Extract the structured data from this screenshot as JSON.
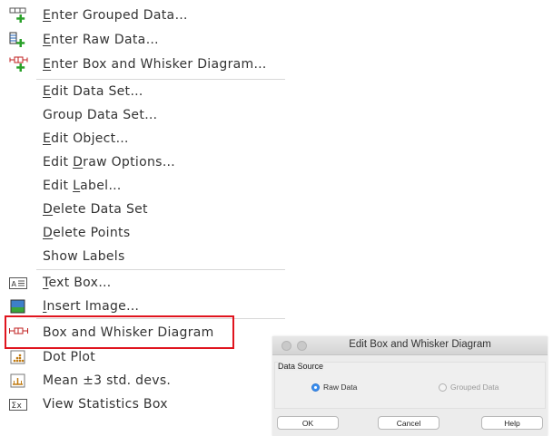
{
  "menu": {
    "items": [
      {
        "key": "enter_grouped",
        "prefix": "",
        "ul": "E",
        "rest": "nter Grouped Data…",
        "icon": "grouped-data-add-icon"
      },
      {
        "key": "enter_raw",
        "prefix": "",
        "ul": "E",
        "rest": "nter Raw Data…",
        "icon": "raw-data-add-icon"
      },
      {
        "key": "enter_box",
        "prefix": "",
        "ul": "E",
        "rest": "nter Box and Whisker Diagram…",
        "icon": "box-whisker-add-icon"
      },
      {
        "key": "edit_data_set",
        "prefix": "",
        "ul": "E",
        "rest": "dit Data Set…",
        "icon": ""
      },
      {
        "key": "group_data_set",
        "prefix": "Group Data Set…",
        "ul": "",
        "rest": "",
        "icon": ""
      },
      {
        "key": "edit_object",
        "prefix": "",
        "ul": "E",
        "rest": "dit Object…",
        "icon": ""
      },
      {
        "key": "edit_draw",
        "prefix": "Edit ",
        "ul": "D",
        "rest": "raw Options…",
        "icon": ""
      },
      {
        "key": "edit_label",
        "prefix": "Edit ",
        "ul": "L",
        "rest": "abel…",
        "icon": ""
      },
      {
        "key": "delete_data_set",
        "prefix": "",
        "ul": "D",
        "rest": "elete Data Set",
        "icon": ""
      },
      {
        "key": "delete_points",
        "prefix": "",
        "ul": "D",
        "rest": "elete Points",
        "icon": ""
      },
      {
        "key": "show_labels",
        "prefix": "Show Labels",
        "ul": "",
        "rest": "",
        "icon": ""
      },
      {
        "key": "text_box",
        "prefix": "",
        "ul": "T",
        "rest": "ext Box…",
        "icon": "text-box-icon"
      },
      {
        "key": "insert_image",
        "prefix": "",
        "ul": "I",
        "rest": "nsert Image…",
        "icon": "image-icon"
      },
      {
        "key": "box_whisker",
        "prefix": "Box and Whisker Diagram",
        "ul": "",
        "rest": "",
        "icon": "box-whisker-icon"
      },
      {
        "key": "dot_plot",
        "prefix": "Dot Plot",
        "ul": "",
        "rest": "",
        "icon": "dot-plot-icon"
      },
      {
        "key": "mean_std",
        "prefix": "Mean ±3 std. devs.",
        "ul": "",
        "rest": "",
        "icon": "mean-std-icon"
      },
      {
        "key": "view_stats",
        "prefix": "View Statistics Box",
        "ul": "",
        "rest": "",
        "icon": "statistics-box-icon"
      }
    ],
    "highlighted": "Box and Whisker Diagram",
    "highlight_color": "#e0141e"
  },
  "dialog": {
    "title": "Edit Box and Whisker Diagram",
    "group_label": "Data Source",
    "radio_raw": "Raw Data",
    "radio_grouped": "Grouped Data",
    "selected": "Raw Data",
    "ok_label": "OK",
    "cancel_label": "Cancel",
    "help_label": "Help",
    "accent": "#3b8ff0"
  }
}
